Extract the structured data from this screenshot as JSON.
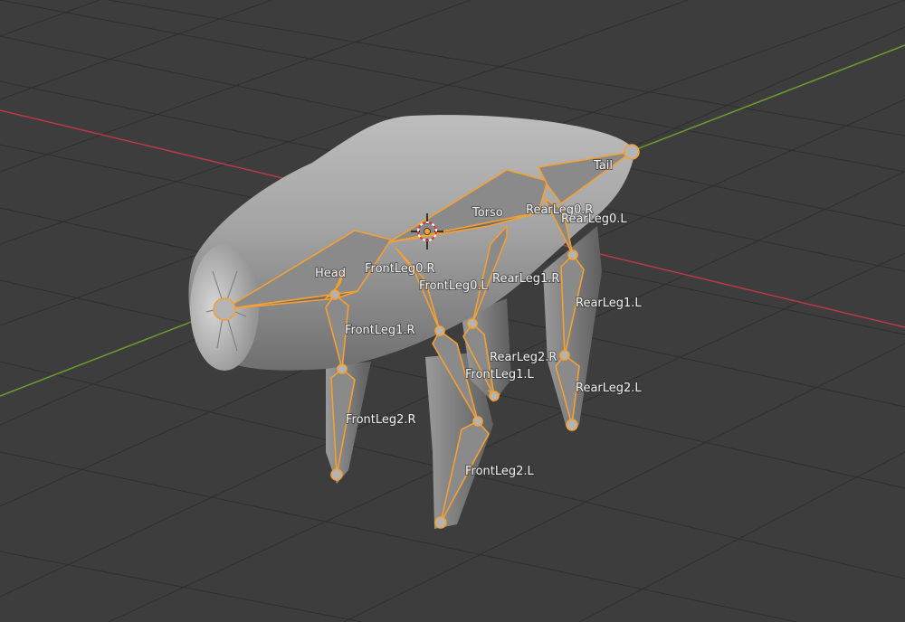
{
  "viewport": {
    "colors": {
      "background": "#3d3d3d",
      "grid": "#2f2f2f",
      "x_axis": "#b83a47",
      "y_axis": "#6e9c2e",
      "mesh": "#a9a9a9",
      "bone_outline": "#f5a032",
      "bone_fill": "#8a8a8a"
    },
    "cursor_icon": "3d-cursor-icon",
    "bones": [
      {
        "key": "head",
        "label": "Head"
      },
      {
        "key": "torso",
        "label": "Torso"
      },
      {
        "key": "tail",
        "label": "Tail"
      },
      {
        "key": "frontleg0_r",
        "label": "FrontLeg0.R"
      },
      {
        "key": "frontleg0_l",
        "label": "FrontLeg0.L"
      },
      {
        "key": "frontleg1_r",
        "label": "FrontLeg1.R"
      },
      {
        "key": "frontleg1_l",
        "label": "FrontLeg1.L"
      },
      {
        "key": "frontleg2_r",
        "label": "FrontLeg2.R"
      },
      {
        "key": "frontleg2_l",
        "label": "FrontLeg2.L"
      },
      {
        "key": "rearleg0_r",
        "label": "RearLeg0.R"
      },
      {
        "key": "rearleg0_l",
        "label": "RearLeg0.L"
      },
      {
        "key": "rearleg1_r",
        "label": "RearLeg1.R"
      },
      {
        "key": "rearleg1_l",
        "label": "RearLeg1.L"
      },
      {
        "key": "rearleg2_r",
        "label": "RearLeg2.R"
      },
      {
        "key": "rearleg2_l",
        "label": "RearLeg2.L"
      }
    ]
  }
}
